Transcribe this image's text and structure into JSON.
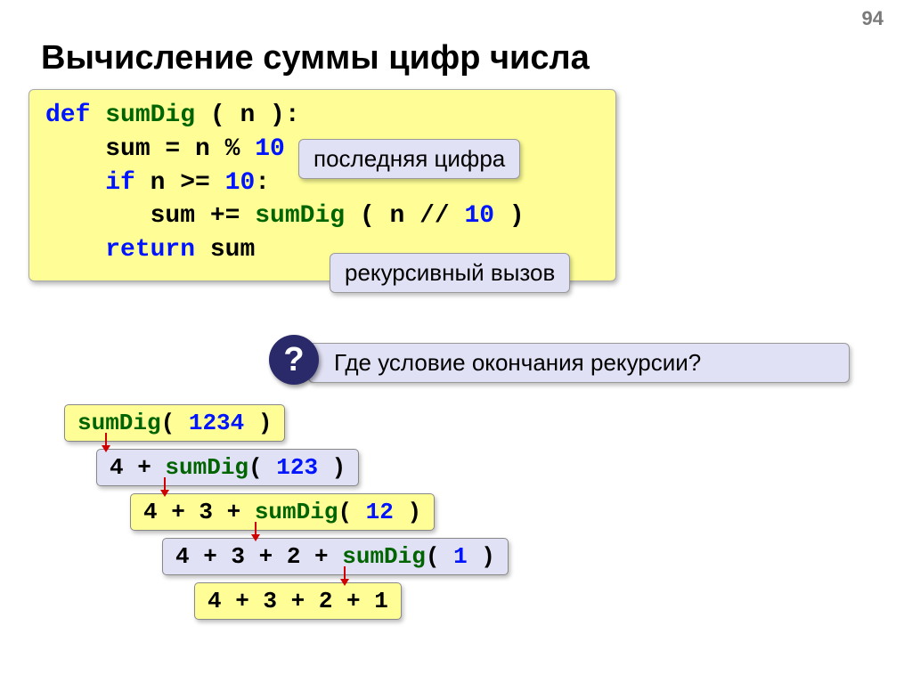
{
  "page_number": "94",
  "title": "Вычисление суммы цифр числа",
  "code": {
    "l1": {
      "kw": "def",
      "fn": " sumDig ",
      "args": "( n ):"
    },
    "l2": {
      "pre": "    sum = n % ",
      "n1": "10"
    },
    "l3": {
      "kw": "    if",
      "mid": " n >= ",
      "n1": "10",
      "post": ":"
    },
    "l4": {
      "pre": "       sum += ",
      "fn": "sumDig ",
      "args": "( n // ",
      "n1": "10",
      "post": " )"
    },
    "l5": {
      "kw": "    return",
      "post": " sum"
    }
  },
  "callout1": "последняя цифра",
  "callout2": "рекурсивный вызов",
  "question": "Где условие окончания рекурсии?",
  "rec": {
    "r1": {
      "fn": "sumDig",
      "lp": "( ",
      "n": "1234",
      "rp": " )"
    },
    "r2": {
      "pre": "4 + ",
      "fn": "sumDig",
      "lp": "( ",
      "n": "123",
      "rp": " )"
    },
    "r3": {
      "pre": "4 + 3 + ",
      "fn": "sumDig",
      "lp": "( ",
      "n": "12",
      "rp": " )"
    },
    "r4": {
      "pre": "4 + 3 + 2 + ",
      "fn": "sumDig",
      "lp": "( ",
      "n": "1",
      "rp": " )"
    },
    "r5": "4 + 3 + 2 + 1"
  },
  "qmark": "?"
}
